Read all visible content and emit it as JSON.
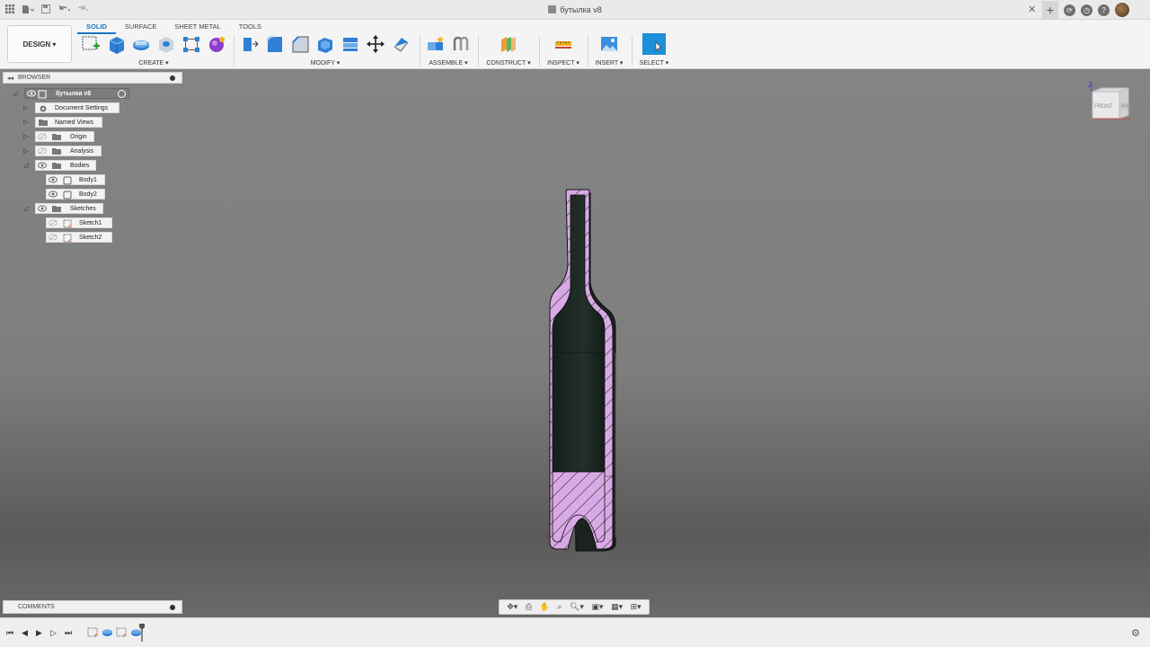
{
  "window": {
    "title": "бутылка v8"
  },
  "toolbar": {
    "workspace": "DESIGN",
    "tabs": [
      "SOLID",
      "SURFACE",
      "SHEET METAL",
      "TOOLS"
    ],
    "groups": {
      "create": "CREATE",
      "modify": "MODIFY",
      "assemble": "ASSEMBLE",
      "construct": "CONSTRUCT",
      "inspect": "INSPECT",
      "insert": "INSERT",
      "select": "SELECT"
    }
  },
  "browser": {
    "title": "BROWSER",
    "root": "бутылка v8",
    "items": [
      {
        "label": "Document Settings"
      },
      {
        "label": "Named Views"
      },
      {
        "label": "Origin"
      },
      {
        "label": "Analysis"
      },
      {
        "label": "Bodies"
      },
      {
        "label": "Body1"
      },
      {
        "label": "Body2"
      },
      {
        "label": "Sketches"
      },
      {
        "label": "Sketch1"
      },
      {
        "label": "Sketch2"
      }
    ]
  },
  "viewcube": {
    "front": "FRONT",
    "right": "RIGHT",
    "axis_z": "Z",
    "axis_x": "X"
  },
  "comments": {
    "title": "COMMENTS"
  },
  "colors": {
    "accent": "#1a74c2",
    "section_hatch": "#d9a9e6",
    "bottle_body": "#1f2b24"
  }
}
